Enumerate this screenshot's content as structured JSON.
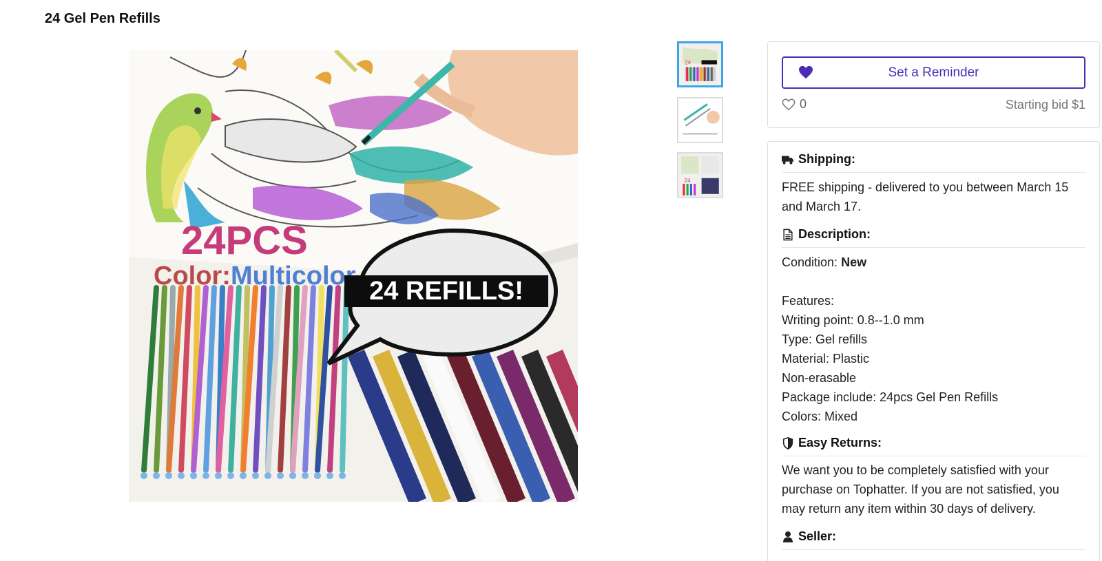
{
  "page": {
    "title": "24 Gel Pen Refills"
  },
  "gallery": {
    "image_text": {
      "count": "24PCS",
      "color_label": "Color:",
      "color_value": "Multicolor",
      "bubble": "24 REFILLS!"
    },
    "thumbnails": [
      {
        "name": "thumbnail-1",
        "active": true
      },
      {
        "name": "thumbnail-2",
        "active": false
      },
      {
        "name": "thumbnail-3",
        "active": false
      }
    ]
  },
  "bid_panel": {
    "reminder_label": "Set a Reminder",
    "likes": "0",
    "starting_bid": "Starting bid $1"
  },
  "details": {
    "shipping": {
      "heading": "Shipping:",
      "text": "FREE shipping - delivered to you between March 15 and March 17."
    },
    "description": {
      "heading": "Description:",
      "condition_label": "Condition:",
      "condition_value": "New",
      "features": [
        "Features:",
        "Writing point: 0.8--1.0 mm",
        "Type: Gel refills",
        "Material: Plastic",
        "Non-erasable",
        "Package include: 24pcs Gel Pen Refills",
        "Colors: Mixed"
      ]
    },
    "returns": {
      "heading": "Easy Returns:",
      "text": "We want you to be completely satisfied with your purchase on Tophatter. If you are not satisfied, you may return any item within 30 days of delivery."
    },
    "seller": {
      "heading": "Seller:"
    }
  },
  "colors": {
    "accent": "#4b2bb8",
    "thumb_active_border": "#3aa6e8"
  }
}
